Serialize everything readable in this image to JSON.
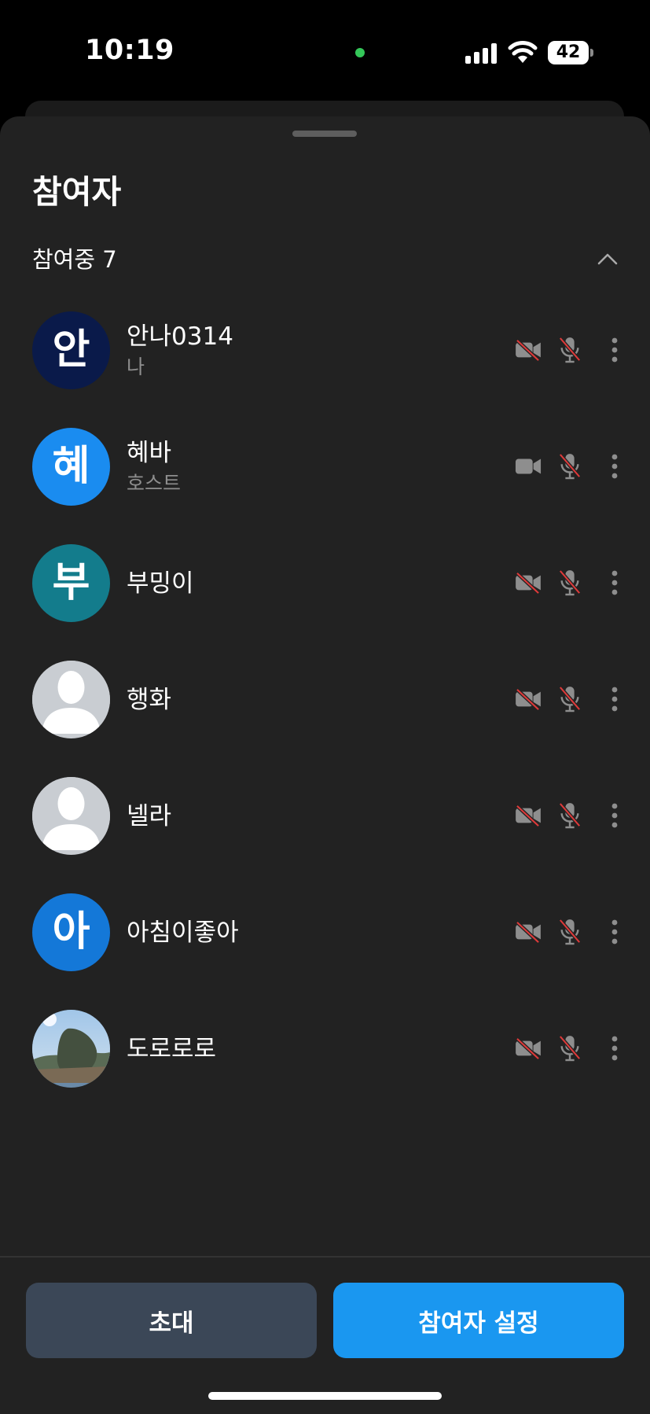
{
  "status_bar": {
    "time": "10:19",
    "battery": "42",
    "icons": [
      "camera-in-use-dot",
      "cellular-signal-icon",
      "wifi-icon",
      "battery-icon"
    ]
  },
  "sheet": {
    "title": "참여자",
    "section_label": "참여중 7",
    "section_icon": "chevron-up-icon"
  },
  "participants": [
    {
      "initial": "안",
      "name": "안나0314",
      "role": "나",
      "avatar_color": "#0a1a4a",
      "avatar_type": "initial",
      "camera": "off",
      "mic": "off"
    },
    {
      "initial": "혜",
      "name": "혜바",
      "role": "호스트",
      "avatar_color": "#1a8cf0",
      "avatar_type": "initial",
      "camera": "on",
      "mic": "off"
    },
    {
      "initial": "부",
      "name": "부밍이",
      "role": "",
      "avatar_color": "#137c8c",
      "avatar_type": "initial",
      "camera": "off",
      "mic": "off"
    },
    {
      "initial": "",
      "name": "행화",
      "role": "",
      "avatar_color": "#c9cdd2",
      "avatar_type": "default-person",
      "camera": "off",
      "mic": "off"
    },
    {
      "initial": "",
      "name": "넬라",
      "role": "",
      "avatar_color": "#c9cdd2",
      "avatar_type": "default-person",
      "camera": "off",
      "mic": "off"
    },
    {
      "initial": "아",
      "name": "아침이좋아",
      "role": "",
      "avatar_color": "#1478d8",
      "avatar_type": "initial",
      "camera": "off",
      "mic": "off"
    },
    {
      "initial": "",
      "name": "도로로로",
      "role": "",
      "avatar_color": "#6a8aa8",
      "avatar_type": "photo",
      "camera": "off",
      "mic": "off"
    }
  ],
  "buttons": {
    "invite": "초대",
    "settings": "참여자 설정"
  },
  "colors": {
    "sheet_bg": "#222222",
    "accent": "#1a97f0",
    "secondary_button": "#3b4757",
    "muted_slash": "#e03a3a",
    "icon_gray": "#8e8e8e"
  }
}
